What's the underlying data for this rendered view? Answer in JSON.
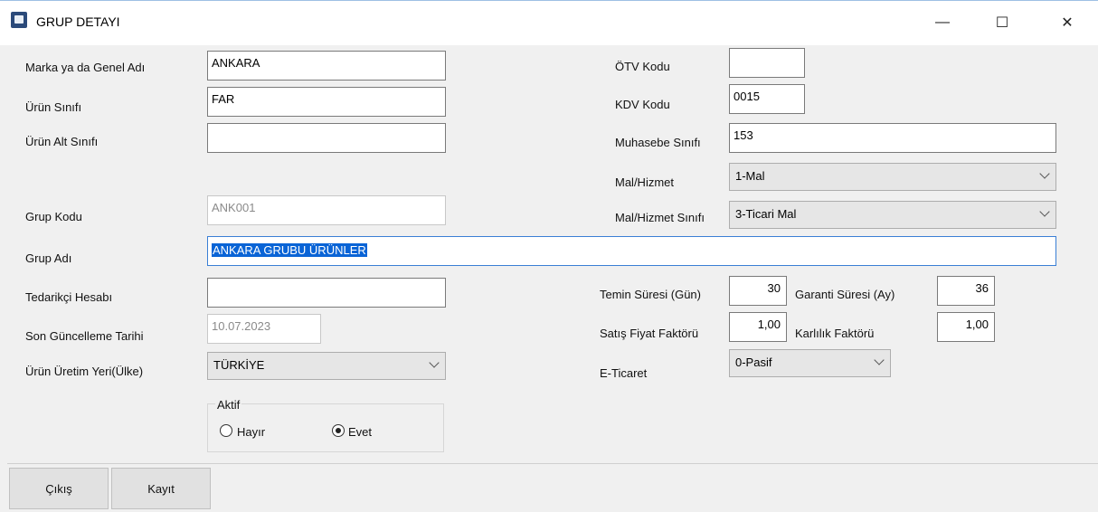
{
  "window": {
    "title": "GRUP DETAYI",
    "minimize": "—",
    "maximize": "☐",
    "close": "✕"
  },
  "left": {
    "marka_label": "Marka ya da Genel Adı",
    "marka_value": "ANKARA",
    "urun_sinifi_label": "Ürün Sınıfı",
    "urun_sinifi_value": "FAR",
    "urun_alt_sinifi_label": "Ürün Alt Sınıfı",
    "urun_alt_sinifi_value": "",
    "grup_kodu_label": "Grup Kodu",
    "grup_kodu_value": "ANK001",
    "grup_adi_label": "Grup Adı",
    "grup_adi_value": "ANKARA GRUBU ÜRÜNLER",
    "tedarikci_label": "Tedarikçi Hesabı",
    "tedarikci_value": "",
    "son_guncelleme_label": "Son Güncelleme Tarihi",
    "son_guncelleme_value": "10.07.2023",
    "uretim_yeri_label": "Ürün Üretim Yeri(Ülke)",
    "uretim_yeri_value": "TÜRKİYE"
  },
  "aktif": {
    "legend": "Aktif",
    "option_no": "Hayır",
    "option_yes": "Evet",
    "selected": "Evet"
  },
  "right": {
    "otv_label": "ÖTV Kodu",
    "otv_value": "",
    "kdv_label": "KDV Kodu",
    "kdv_value": "0015",
    "muhasebe_label": "Muhasebe Sınıfı",
    "muhasebe_value": "153",
    "mal_hizmet_label": "Mal/Hizmet",
    "mal_hizmet_value": "1-Mal",
    "mal_hizmet_sinifi_label": "Mal/Hizmet Sınıfı",
    "mal_hizmet_sinifi_value": "3-Ticari Mal",
    "temin_label": "Temin Süresi (Gün)",
    "temin_value": "30",
    "garanti_label": "Garanti Süresi (Ay)",
    "garanti_value": "36",
    "satis_label": "Satış Fiyat Faktörü",
    "satis_value": "1,00",
    "karlilik_label": "Karlılık Faktörü",
    "karlilik_value": "1,00",
    "eticaret_label": "E-Ticaret",
    "eticaret_value": "0-Pasif"
  },
  "footer": {
    "cikis_label": "Çıkış",
    "kayit_label": "Kayıt"
  }
}
